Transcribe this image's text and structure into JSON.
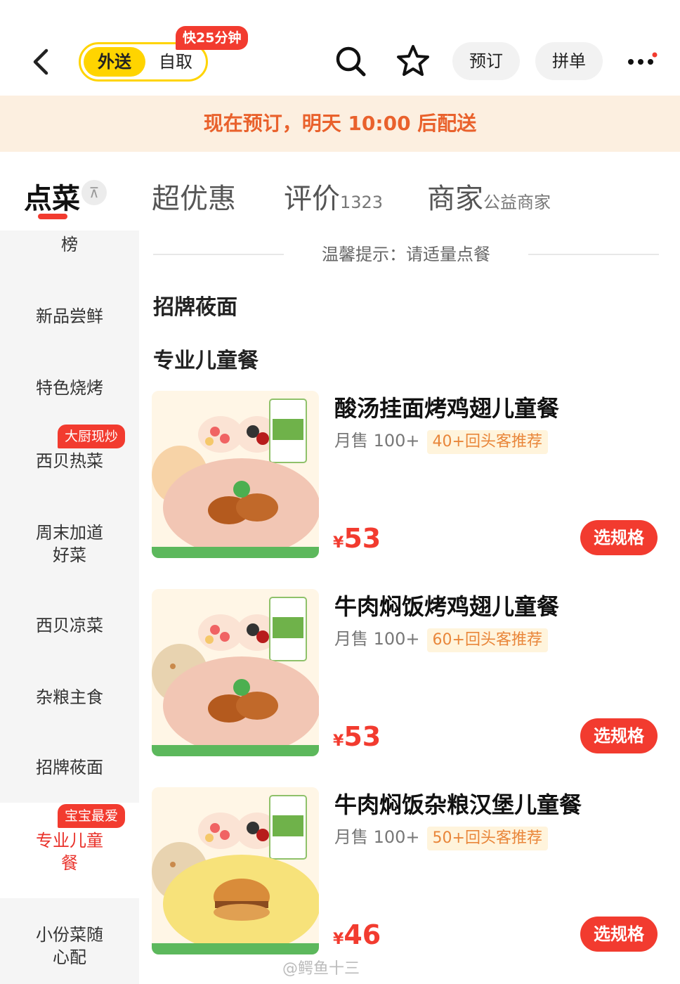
{
  "header": {
    "mode_delivery": "外送",
    "mode_pickup": "自取",
    "fast_badge": "快25分钟",
    "reserve_label": "预订",
    "group_label": "拼单"
  },
  "banner": {
    "text": "现在预订，明天 10:00 后配送"
  },
  "tabs": [
    {
      "label": "点菜",
      "sub": ""
    },
    {
      "label": "超优惠",
      "sub": ""
    },
    {
      "label": "评价",
      "sub": "1323"
    },
    {
      "label": "商家",
      "sub": "公益商家"
    }
  ],
  "sidebar": {
    "items": [
      {
        "label": "榜"
      },
      {
        "label": "新品尝鲜"
      },
      {
        "label": "特色烧烤"
      },
      {
        "label": "西贝热菜",
        "badge": "大厨现炒"
      },
      {
        "label": "周末加道好菜"
      },
      {
        "label": "西贝凉菜"
      },
      {
        "label": "杂粮主食"
      },
      {
        "label": "招牌莜面"
      },
      {
        "label": "专业儿童餐",
        "badge": "宝宝最爱"
      },
      {
        "label": "小份菜随心配"
      }
    ]
  },
  "main": {
    "notice": "温馨提示：请适量点餐",
    "sections": [
      "招牌莜面",
      "专业儿童餐"
    ],
    "products": [
      {
        "title": "酸汤挂面烤鸡翅儿童餐",
        "sales": "月售 100+",
        "tag": "40+回头客推荐",
        "currency": "¥",
        "price": "53",
        "button": "选规格",
        "bowl_color": "#f2c6b4"
      },
      {
        "title": "牛肉焖饭烤鸡翅儿童餐",
        "sales": "月售 100+",
        "tag": "60+回头客推荐",
        "currency": "¥",
        "price": "53",
        "button": "选规格",
        "bowl_color": "#f2c6b4"
      },
      {
        "title": "牛肉焖饭杂粮汉堡儿童餐",
        "sales": "月售 100+",
        "tag": "50+回头客推荐",
        "currency": "¥",
        "price": "46",
        "button": "选规格",
        "bowl_color": "#f7e27a"
      }
    ]
  },
  "watermark": "@鳄鱼十三",
  "colors": {
    "brand_red": "#f23b2f",
    "brand_yellow": "#ffd400",
    "banner_bg": "#fcefe0",
    "banner_text": "#e9612c"
  }
}
